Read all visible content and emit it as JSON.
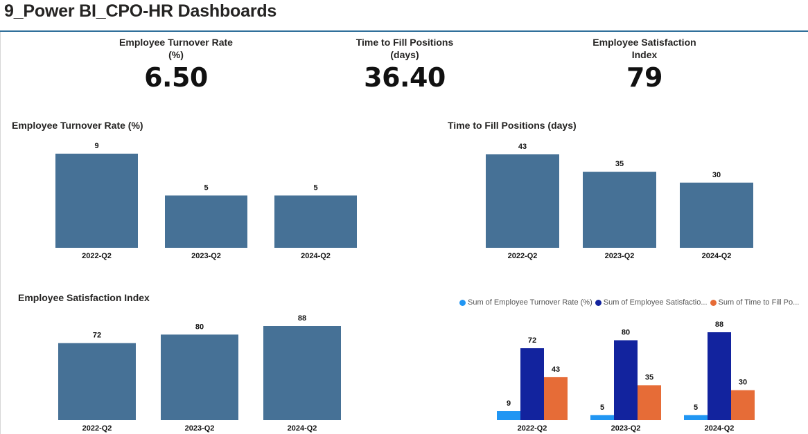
{
  "header": {
    "title": "9_Power BI_CPO-HR Dashboards"
  },
  "kpis": [
    {
      "label_line1": "Employee Turnover Rate",
      "label_line2": "(%)",
      "value": "6.50"
    },
    {
      "label_line1": "Time to Fill Positions",
      "label_line2": "(days)",
      "value": "36.40"
    },
    {
      "label_line1": "Employee Satisfaction",
      "label_line2": "Index",
      "value": "79"
    }
  ],
  "charts": {
    "turnover_title": "Employee Turnover Rate (%)",
    "fill_title": "Time to Fill Positions (days)",
    "satisfaction_title": "Employee Satisfaction Index",
    "legend": [
      {
        "label": "Sum of Employee Turnover Rate (%)",
        "color": "#2196f3"
      },
      {
        "label": "Sum of Employee Satisfactio...",
        "color": "#12239e"
      },
      {
        "label": "Sum of Time to Fill Po...",
        "color": "#e66c37"
      }
    ]
  },
  "colors": {
    "bar": "#467196",
    "turnover": "#2196f3",
    "satisfaction": "#12239e",
    "fill": "#e66c37"
  },
  "chart_data": [
    {
      "type": "bar",
      "title": "Employee Turnover Rate (%)",
      "categories": [
        "2022-Q2",
        "2023-Q2",
        "2024-Q2"
      ],
      "values": [
        9,
        5,
        5
      ]
    },
    {
      "type": "bar",
      "title": "Time to Fill Positions (days)",
      "categories": [
        "2022-Q2",
        "2023-Q2",
        "2024-Q2"
      ],
      "values": [
        43,
        35,
        30
      ]
    },
    {
      "type": "bar",
      "title": "Employee Satisfaction Index",
      "categories": [
        "2022-Q2",
        "2023-Q2",
        "2024-Q2"
      ],
      "values": [
        72,
        80,
        88
      ]
    },
    {
      "type": "bar",
      "categories": [
        "2022-Q2",
        "2023-Q2",
        "2024-Q2"
      ],
      "series": [
        {
          "name": "Sum of Employee Turnover Rate (%)",
          "values": [
            9,
            5,
            5
          ]
        },
        {
          "name": "Sum of Employee Satisfactio...",
          "values": [
            72,
            80,
            88
          ]
        },
        {
          "name": "Sum of Time to Fill Po...",
          "values": [
            43,
            35,
            30
          ]
        }
      ]
    }
  ]
}
